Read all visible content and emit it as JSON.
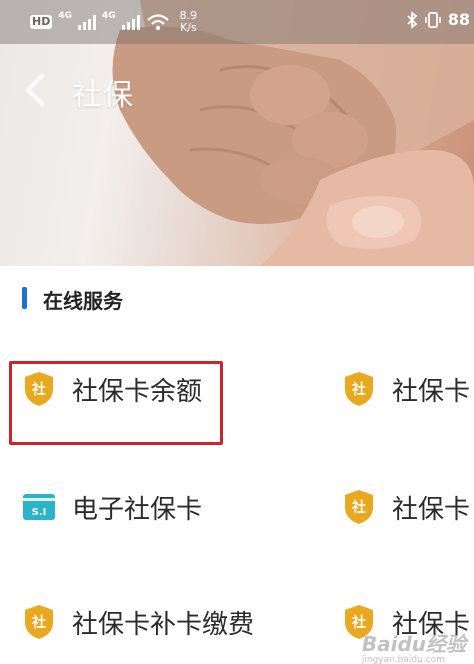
{
  "status_bar": {
    "hd_badge": "HD",
    "network_1": "4G",
    "network_2": "4G",
    "speed_value": "8.9",
    "speed_unit": "K/s",
    "battery": "88"
  },
  "header": {
    "title": "社保"
  },
  "section": {
    "title": "在线服务"
  },
  "services": [
    {
      "label": "社保卡余额",
      "icon": "social-security-shield-icon",
      "icon_text": "社"
    },
    {
      "label": "社保卡",
      "icon": "social-security-shield-icon",
      "icon_text": "社"
    },
    {
      "label": "电子社保卡",
      "icon": "electronic-card-icon",
      "icon_text": "S.I"
    },
    {
      "label": "社保卡",
      "icon": "social-security-shield-icon",
      "icon_text": "社"
    },
    {
      "label": "社保卡补卡缴费",
      "icon": "social-security-shield-icon",
      "icon_text": "社"
    },
    {
      "label": "社保卡",
      "icon": "social-security-shield-icon",
      "icon_text": "社"
    }
  ],
  "watermark": {
    "text": "Baidu经验",
    "subtext": "jingyan.baidu.com"
  },
  "colors": {
    "accent": "#1f6fd6",
    "shield": "#e8a91e",
    "card_icon": "#2bb3c9",
    "highlight": "#c9262c"
  }
}
